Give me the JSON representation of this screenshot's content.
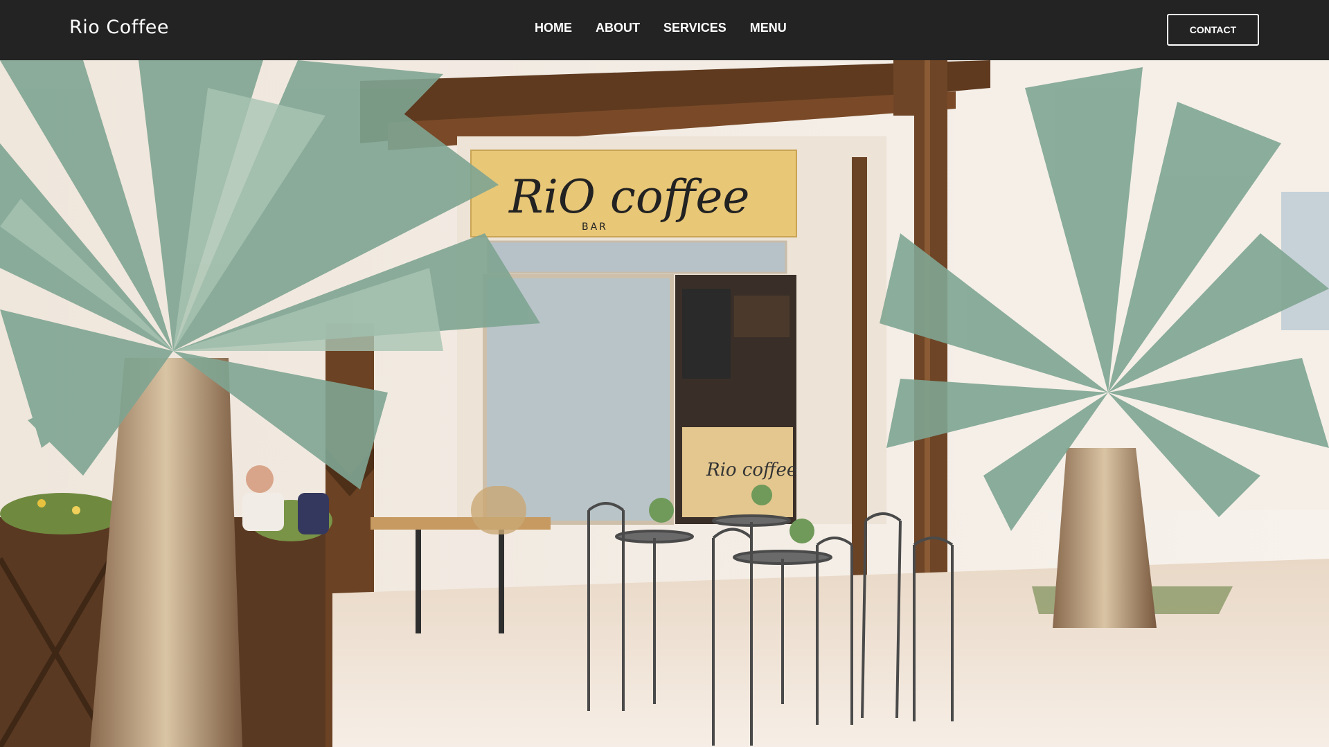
{
  "header": {
    "brand": "Rio Coffee",
    "nav": [
      "HOME",
      "ABOUT",
      "SERVICES",
      "MENU"
    ],
    "contact_label": "CONTACT"
  },
  "hero": {
    "sign_text": "RiO coffee",
    "sign_subtext": "BAR",
    "chalkboard_text": "Rio coffee"
  },
  "colors": {
    "navbar": "#232323",
    "wood": "#6e4526",
    "sign": "#e8c777",
    "palm": "#7fa592",
    "floor": "#f1e6da"
  }
}
